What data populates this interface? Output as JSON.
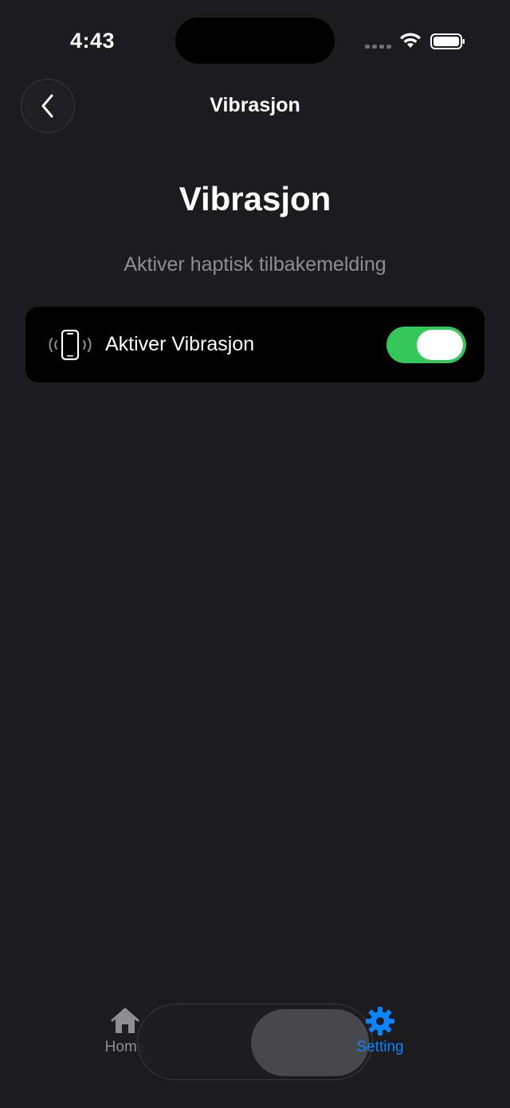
{
  "status_bar": {
    "time": "4:43",
    "wifi_icon": "wifi-icon",
    "battery_icon": "battery-icon"
  },
  "nav": {
    "back_icon": "chevron-left-icon",
    "title": "Vibrasjon"
  },
  "page": {
    "title": "Vibrasjon",
    "subtitle": "Aktiver haptisk tilbakemelding"
  },
  "settings": {
    "vibration_row": {
      "icon": "phone-vibrate-icon",
      "label": "Aktiver Vibrasjon",
      "enabled": true,
      "toggle_color": "#34c759"
    }
  },
  "tab_bar": {
    "items": [
      {
        "label": "Home",
        "icon": "house-icon",
        "active": false
      },
      {
        "label": "Setting",
        "icon": "gear-icon",
        "active": true
      }
    ],
    "active_color": "#0a84ff",
    "inactive_color": "#8e8e93"
  }
}
